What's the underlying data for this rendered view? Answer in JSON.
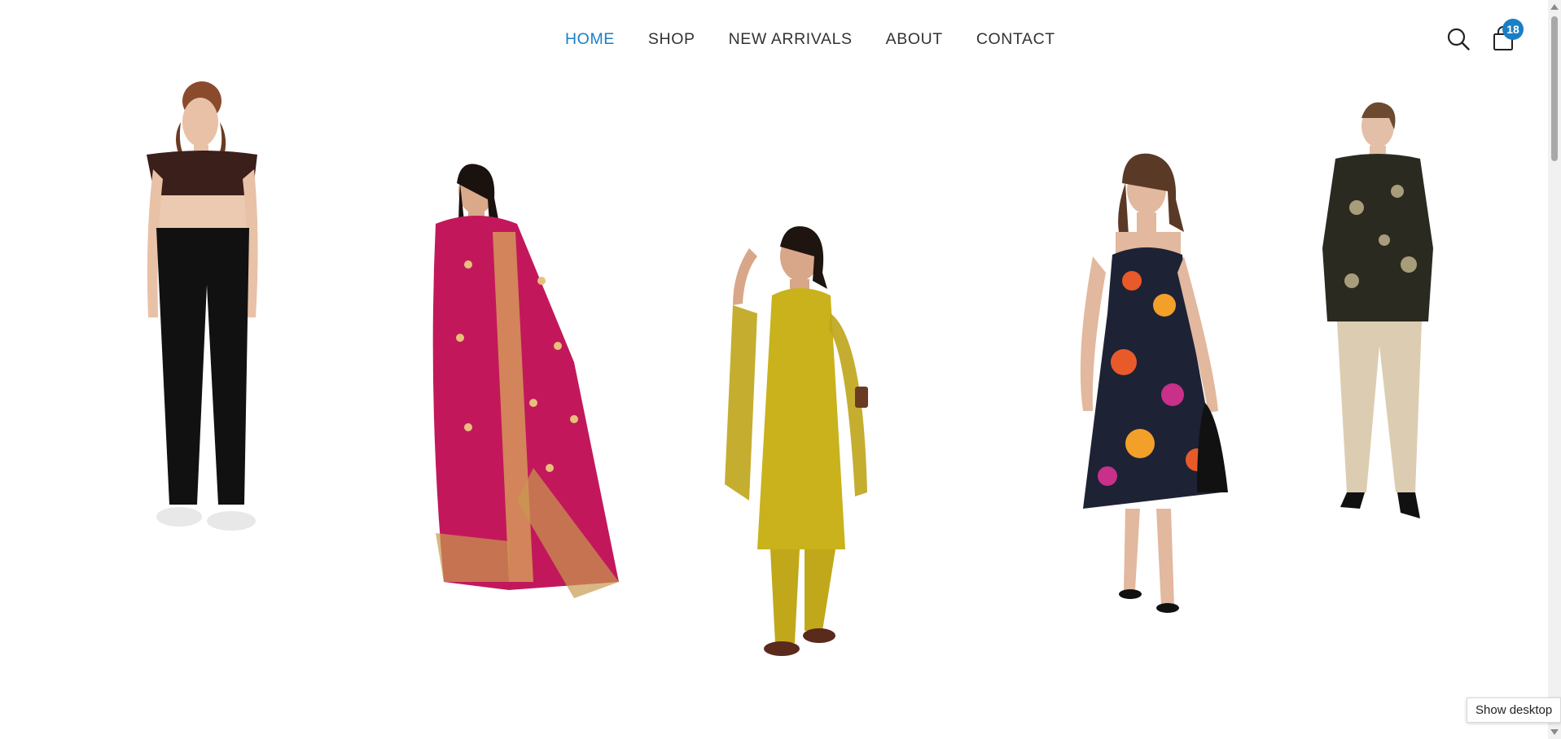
{
  "nav": {
    "items": [
      {
        "label": "HOME",
        "active": true
      },
      {
        "label": "SHOP",
        "active": false
      },
      {
        "label": "NEW ARRIVALS",
        "active": false
      },
      {
        "label": "ABOUT",
        "active": false
      },
      {
        "label": "CONTACT",
        "active": false
      }
    ]
  },
  "header_icons": {
    "search": "search-icon",
    "cart": "shopping-bag-icon",
    "cart_count": "18"
  },
  "colors": {
    "accent": "#1a7fc4",
    "nav_text": "#333333"
  },
  "models": [
    {
      "name": "crop-top-jeans-model",
      "top": "#3a1f1a",
      "bottom": "#111111"
    },
    {
      "name": "pink-saree-model",
      "top": "#c2185b",
      "bottom": "#c2185b"
    },
    {
      "name": "yellow-kurta-model",
      "top": "#c9b21c",
      "bottom": "#c0a81a"
    },
    {
      "name": "floral-dress-model",
      "top": "#1e2235",
      "bottom": "#1e2235"
    },
    {
      "name": "black-blouse-beige-pants-model",
      "top": "#2b2a20",
      "bottom": "#dccdb2"
    }
  ],
  "tooltip": {
    "text": "Show desktop"
  }
}
